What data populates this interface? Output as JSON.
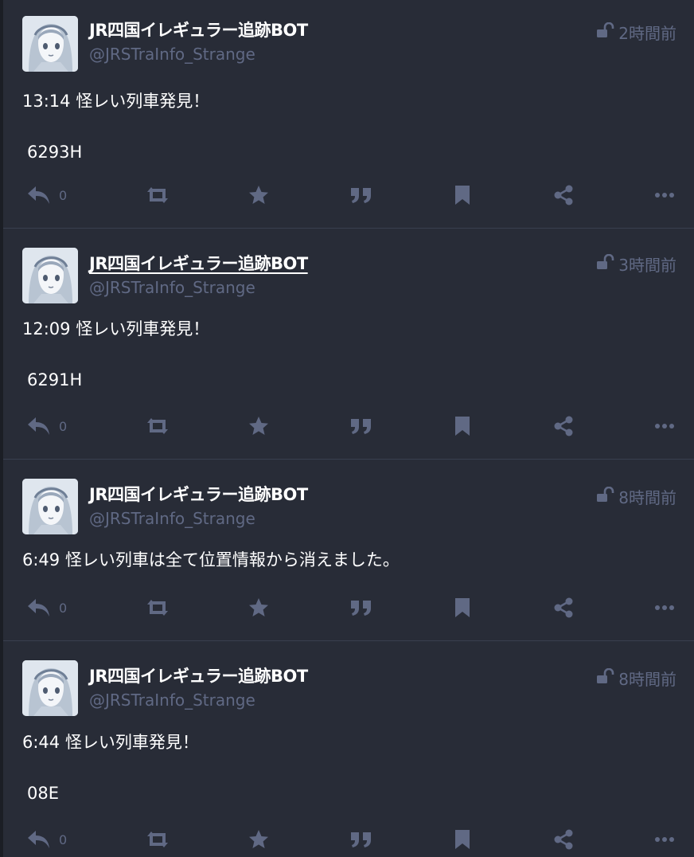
{
  "colors": {
    "background": "#282c37",
    "divider": "#393f4f",
    "muted": "#606984",
    "text": "#ffffff"
  },
  "posts": [
    {
      "display_name": "JR四国イレギュラー追跡BOT",
      "acct": "@JRSTraInfo_Strange",
      "visibility_icon": "unlocked-icon",
      "time": "2時間前",
      "paragraphs": [
        "13:14 怪レい列車発見！",
        "6293H"
      ],
      "reply_count": "0"
    },
    {
      "display_name": "JR四国イレギュラー追跡BOT",
      "acct": "@JRSTraInfo_Strange",
      "visibility_icon": "unlocked-icon",
      "time": "3時間前",
      "paragraphs": [
        "12:09 怪レい列車発見！",
        "6291H"
      ],
      "reply_count": "0"
    },
    {
      "display_name": "JR四国イレギュラー追跡BOT",
      "acct": "@JRSTraInfo_Strange",
      "visibility_icon": "unlocked-icon",
      "time": "8時間前",
      "paragraphs": [
        "6:49 怪レい列車は全て位置情報から消えました。"
      ],
      "reply_count": "0"
    },
    {
      "display_name": "JR四国イレギュラー追跡BOT",
      "acct": "@JRSTraInfo_Strange",
      "visibility_icon": "unlocked-icon",
      "time": "8時間前",
      "paragraphs": [
        "6:44 怪レい列車発見！",
        "08E"
      ],
      "reply_count": "0"
    }
  ],
  "action_icons": [
    "reply-icon",
    "boost-icon",
    "favourite-icon",
    "quote-icon",
    "bookmark-icon",
    "share-icon",
    "more-icon"
  ]
}
